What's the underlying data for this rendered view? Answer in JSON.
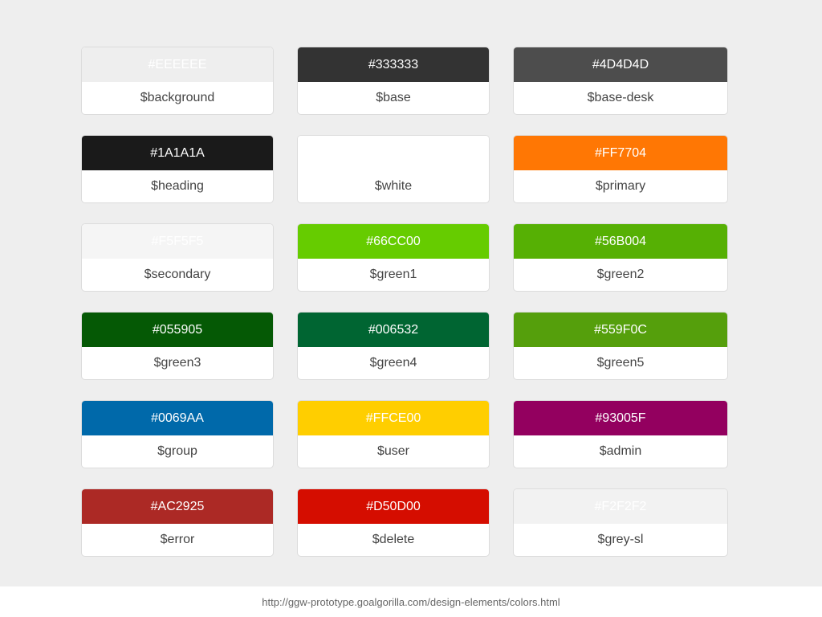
{
  "colors": [
    {
      "hex": "#EEEEEE",
      "name": "$background"
    },
    {
      "hex": "#333333",
      "name": "$base"
    },
    {
      "hex": "#4D4D4D",
      "name": "$base-desk"
    },
    {
      "hex": "#1A1A1A",
      "name": "$heading"
    },
    {
      "hex": "",
      "swatch": "#FFFFFF",
      "name": "$white"
    },
    {
      "hex": "#FF7704",
      "name": "$primary"
    },
    {
      "hex": "#F5F5F5",
      "name": "$secondary"
    },
    {
      "hex": "#66CC00",
      "name": "$green1"
    },
    {
      "hex": "#56B004",
      "name": "$green2"
    },
    {
      "hex": "#055905",
      "name": "$green3"
    },
    {
      "hex": "#006532",
      "name": "$green4"
    },
    {
      "hex": "#559F0C",
      "name": "$green5"
    },
    {
      "hex": "#0069AA",
      "name": "$group"
    },
    {
      "hex": "#FFCE00",
      "name": "$user"
    },
    {
      "hex": "#93005F",
      "name": "$admin"
    },
    {
      "hex": "#AC2925",
      "name": "$error"
    },
    {
      "hex": "#D50D00",
      "name": "$delete"
    },
    {
      "hex": "#F2F2F2",
      "name": "$grey-sl"
    }
  ],
  "footer": {
    "url": "http://ggw-prototype.goalgorilla.com/design-elements/colors.html"
  }
}
